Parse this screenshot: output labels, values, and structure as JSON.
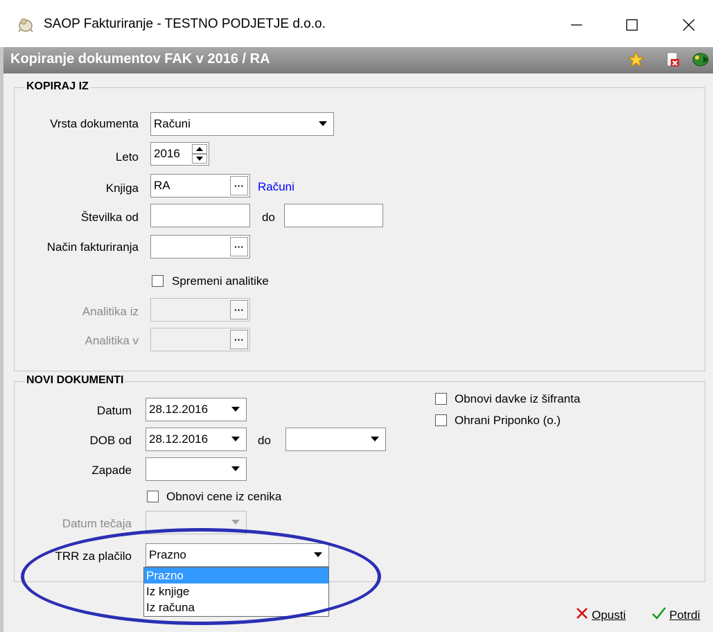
{
  "window": {
    "title": "SAOP Fakturiranje - TESTNO PODJETJE d.o.o.",
    "icon": "saop-app-icon",
    "controls": {
      "minimize": "—",
      "maximize": "☐",
      "close": "✕"
    }
  },
  "header": {
    "title": "Kopiranje dokumentov FAK v 2016 / RA",
    "icons": [
      "star-icon",
      "delete-doc-icon",
      "exit-icon"
    ]
  },
  "kopiraj_iz": {
    "title": "KOPIRAJ IZ",
    "vrsta_dokumenta": {
      "label": "Vrsta dokumenta",
      "value": "Računi"
    },
    "leto": {
      "label": "Leto",
      "value": "2016"
    },
    "knjiga": {
      "label": "Knjiga",
      "value": "RA",
      "link": "Računi"
    },
    "stevilka": {
      "label_od": "Številka od",
      "value_od": "",
      "label_do": "do",
      "value_do": ""
    },
    "nacin_fakturiranja": {
      "label": "Način fakturiranja",
      "value": ""
    },
    "spremeni_analitike": {
      "label": "Spremeni analitike",
      "checked": false
    },
    "analitika_iz": {
      "label": "Analitika iz",
      "value": ""
    },
    "analitika_v": {
      "label": "Analitika v",
      "value": ""
    }
  },
  "novi_dokumenti": {
    "title": "NOVI DOKUMENTI",
    "datum": {
      "label": "Datum",
      "value": "28.12.2016"
    },
    "dob": {
      "label_od": "DOB od",
      "value_od": "28.12.2016",
      "label_do": "do",
      "value_do": ""
    },
    "zapade": {
      "label": "Zapade",
      "value": ""
    },
    "obnovi_cene": {
      "label": "Obnovi cene iz cenika",
      "checked": false
    },
    "datum_tecaja": {
      "label": "Datum tečaja",
      "value": ""
    },
    "trr": {
      "label": "TRR za plačilo",
      "value": "Prazno",
      "options": [
        "Prazno",
        "Iz knjige",
        "Iz računa"
      ],
      "selected_index": 0
    },
    "obnovi_davke": {
      "label": "Obnovi davke iz šifranta",
      "checked": false
    },
    "ohrani_priponko": {
      "label": "Ohrani Priponko (o.)",
      "checked": false
    }
  },
  "buttons": {
    "cancel": "Opusti",
    "confirm": "Potrdi"
  },
  "colors": {
    "header_bg": "#8f8f8f",
    "highlight": "#2b2fb4",
    "selection": "#3399ff",
    "link": "#0000ff"
  }
}
